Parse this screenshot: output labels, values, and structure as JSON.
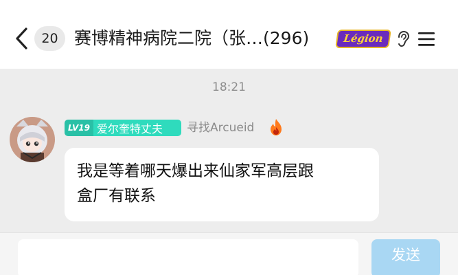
{
  "header": {
    "unread_count": "20",
    "title": "赛博精神病院二院（张…(296)",
    "badge_text": "Légion",
    "icons": {
      "back": "chevron-left-icon",
      "voice": "ear-icon",
      "menu": "hamburger-menu-icon"
    }
  },
  "messages": [
    {
      "time": "18:21",
      "level": "LV19",
      "level_title": "爱尔奎特丈夫",
      "sender": "寻找Arcueid",
      "sender_icon": "fire-icon",
      "text_lines": [
        "我是等着哪天爆出来仙家军高层跟",
        "盒厂有联系"
      ]
    }
  ],
  "composer": {
    "input_value": "",
    "send_label": "发送"
  },
  "colors": {
    "level_tag": "#2fdbbd",
    "send_button": "#a9d7f3",
    "badge_bg": "#6a2bbd",
    "badge_text": "#ffd23a"
  }
}
